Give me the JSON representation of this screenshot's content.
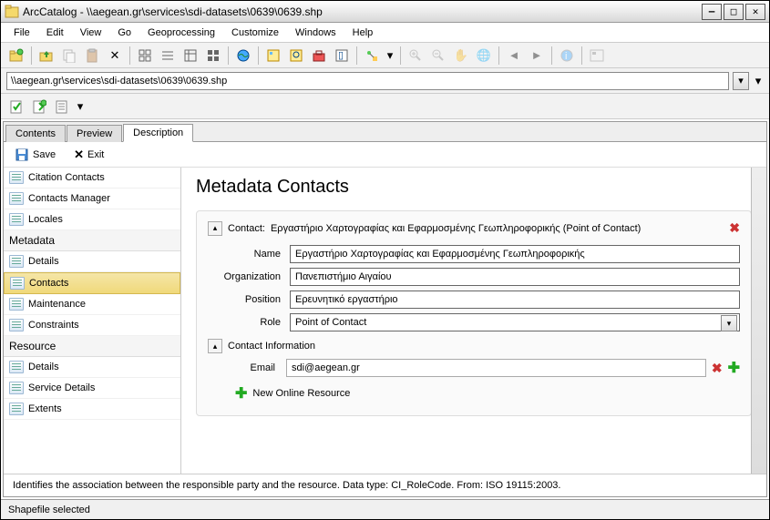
{
  "window": {
    "title": "ArcCatalog - \\\\aegean.gr\\services\\sdi-datasets\\0639\\0639.shp"
  },
  "menu": [
    "File",
    "Edit",
    "View",
    "Go",
    "Geoprocessing",
    "Customize",
    "Windows",
    "Help"
  ],
  "address": "\\\\aegean.gr\\services\\sdi-datasets\\0639\\0639.shp",
  "tabs": {
    "contents": "Contents",
    "preview": "Preview",
    "description": "Description"
  },
  "actions": {
    "save": "Save",
    "exit": "Exit"
  },
  "sidebar": {
    "top": [
      "Citation Contacts",
      "Contacts Manager",
      "Locales"
    ],
    "metadata_header": "Metadata",
    "metadata": [
      "Details",
      "Contacts",
      "Maintenance",
      "Constraints"
    ],
    "resource_header": "Resource",
    "resource": [
      "Details",
      "Service Details",
      "Extents"
    ]
  },
  "panel": {
    "title": "Metadata Contacts",
    "contact_label": "Contact:",
    "contact_value": "Εργαστήριο Χαρτογραφίας και Εφαρμοσμένης Γεωπληροφορικής (Point of Contact)",
    "labels": {
      "name": "Name",
      "org": "Organization",
      "pos": "Position",
      "role": "Role"
    },
    "fields": {
      "name": "Εργαστήριο Χαρτογραφίας και Εφαρμοσμένης Γεωπληροφορικής",
      "org": "Πανεπιστήμιο Αιγαίου",
      "pos": "Ερευνητικό εργαστήριο",
      "role": "Point of Contact"
    },
    "contact_info_header": "Contact Information",
    "email_label": "Email",
    "email": "sdi@aegean.gr",
    "new_online": "New Online Resource"
  },
  "help": "Identifies the association between the responsible party and the resource. Data type: CI_RoleCode. From: ISO 19115:2003.",
  "status": "Shapefile selected"
}
